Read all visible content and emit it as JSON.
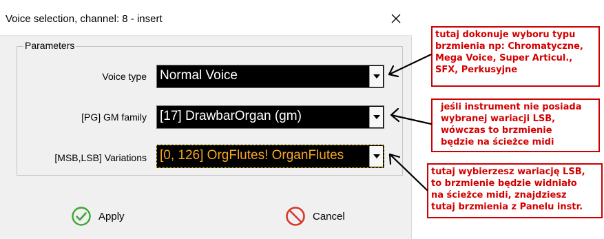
{
  "window": {
    "title": "Voice selection, channel: 8 - insert",
    "close_glyph": "✕"
  },
  "parameters": {
    "legend": "Parameters",
    "rows": [
      {
        "label": "Voice type",
        "value": "Normal Voice"
      },
      {
        "label": "[PG] GM family",
        "value": "[17] DrawbarOrgan (gm)"
      },
      {
        "label": "[MSB,LSB] Variations",
        "value": "[0, 126] OrgFlutes! OrganFlutes"
      }
    ]
  },
  "buttons": {
    "apply": {
      "label": "Apply",
      "icon": "checkmark-circle-icon",
      "color": "#3da535"
    },
    "cancel": {
      "label": "Cancel",
      "icon": "prohibited-icon",
      "color": "#d9362b"
    }
  },
  "annotations": [
    {
      "lines": [
        "tutaj dokonuje wyboru typu",
        "brzmienia np: Chromatyczne,",
        "Mega Voice, Super Articul.,",
        "SFX, Perkusyjne"
      ]
    },
    {
      "lines": [
        "jeśli instrument nie posiada",
        "wybranej wariacji LSB,",
        "wówczas to brzmienie",
        "będzie na ścieżce midi"
      ]
    },
    {
      "lines": [
        "tutaj wybierzesz wariację LSB,",
        "to brzmienie będzie widniało",
        "na ścieżce midi, znajdziesz",
        "tutaj brzmienia z Panelu instr."
      ]
    }
  ],
  "colors": {
    "annotation_text": "#d40000",
    "annotation_border": "#cc0000",
    "combo_bg": "#000000",
    "focused_text": "#f5a623"
  }
}
